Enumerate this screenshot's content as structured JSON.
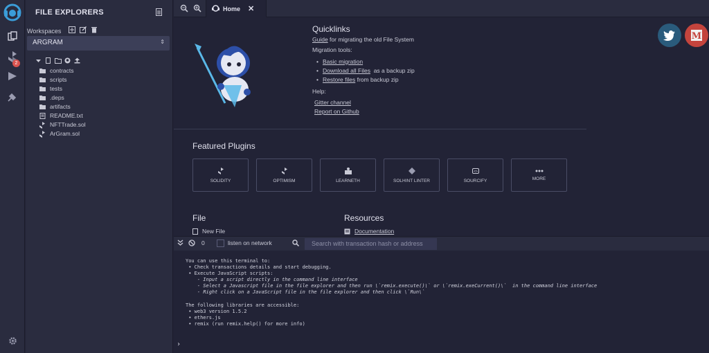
{
  "sidepanel": {
    "title": "FILE EXPLORERS",
    "workspaces_label": "Workspaces",
    "workspace_selected": "ARGRAM",
    "tree": [
      {
        "name": "contracts",
        "type": "folder"
      },
      {
        "name": "scripts",
        "type": "folder"
      },
      {
        "name": "tests",
        "type": "folder"
      },
      {
        "name": ".deps",
        "type": "folder"
      },
      {
        "name": "artifacts",
        "type": "folder"
      },
      {
        "name": "README.txt",
        "type": "file"
      },
      {
        "name": "NFTTrade.sol",
        "type": "sol"
      },
      {
        "name": "ArGram.sol",
        "type": "sol"
      }
    ]
  },
  "activity": {
    "badge_count": "2"
  },
  "tabs": {
    "home_label": "Home"
  },
  "home": {
    "quicklinks_title": "Quicklinks",
    "guide_link": "Guide",
    "guide_text": " for migrating the old File System",
    "migration_title": "Migration tools:",
    "migration": [
      {
        "link": "Basic migration",
        "suffix": ""
      },
      {
        "link": "Download all Files",
        "suffix": "  as a backup zip"
      },
      {
        "link": "Restore files",
        "suffix": " from backup zip"
      }
    ],
    "help_title": "Help:",
    "help_links": [
      "Gitter channel",
      "Report on Github"
    ],
    "featured_title": "Featured Plugins",
    "plugins": [
      "SOLIDITY",
      "OPTIMISM",
      "LEARNETH",
      "SOLHINT LINTER",
      "SOURCIFY",
      "MORE"
    ],
    "file_title": "File",
    "new_file": "New File",
    "resources_title": "Resources",
    "documentation": "Documentation"
  },
  "termbar": {
    "count": "0",
    "listen_label": "listen on network",
    "search_placeholder": "Search with transaction hash or address"
  },
  "terminal": {
    "lines": [
      {
        "text": "You can use this terminal to:",
        "style": ""
      },
      {
        "text": " • Check transactions details and start debugging.",
        "style": ""
      },
      {
        "text": " • Execute JavaScript scripts:",
        "style": ""
      },
      {
        "text": "    - Input a script directly in the command line interface",
        "style": "it"
      },
      {
        "text": "    - Select a Javascript file in the file explorer and then run \\`remix.execute()\\` or \\`remix.exeCurrent()\\`  in the command line interface",
        "style": "it"
      },
      {
        "text": "    - Right click on a JavaScript file in the file explorer and then click \\`Run\\`",
        "style": "it"
      },
      {
        "text": "",
        "style": ""
      },
      {
        "text": "The following libraries are accessible:",
        "style": ""
      },
      {
        "text": " • web3 version 1.5.2",
        "style": ""
      },
      {
        "text": " • ethers.js",
        "style": ""
      },
      {
        "text": " • remix (run remix.help() for more info)",
        "style": ""
      }
    ],
    "prompt": "›"
  },
  "colors": {
    "twitter": "#2a5b7c",
    "medium": "#c4443d",
    "accent": "#3b7ad9"
  }
}
